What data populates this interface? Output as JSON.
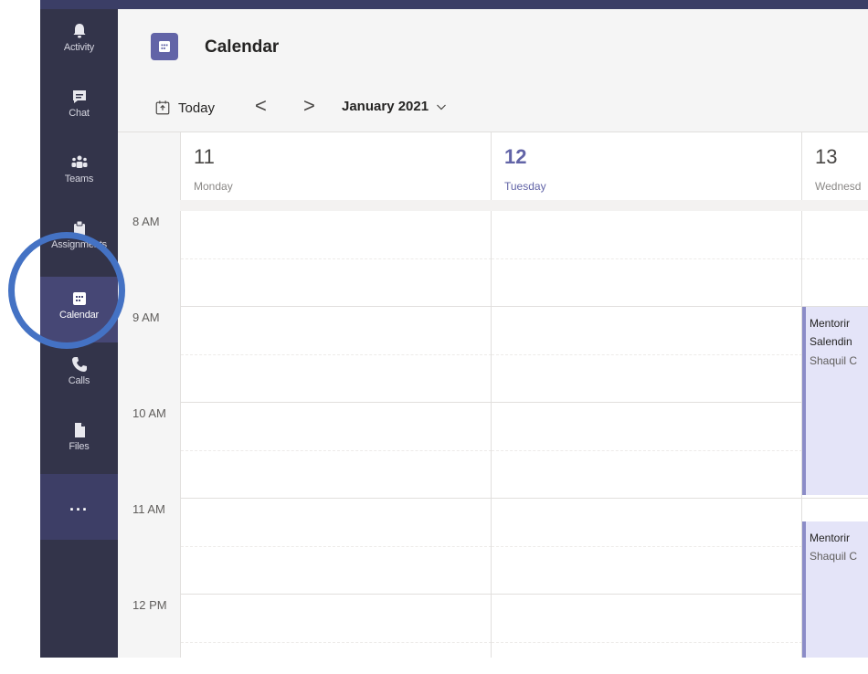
{
  "rail": {
    "items": [
      {
        "label": "Activity",
        "icon": "bell-icon"
      },
      {
        "label": "Chat",
        "icon": "chat-icon"
      },
      {
        "label": "Teams",
        "icon": "teams-icon"
      },
      {
        "label": "Assignments",
        "icon": "assignments-icon"
      },
      {
        "label": "Calendar",
        "icon": "calendar-icon",
        "active": true
      },
      {
        "label": "Calls",
        "icon": "phone-icon"
      },
      {
        "label": "Files",
        "icon": "file-icon"
      }
    ],
    "more_label": "..."
  },
  "header": {
    "title": "Calendar"
  },
  "toolbar": {
    "today_label": "Today",
    "prev_label": "<",
    "next_label": ">",
    "month_label": "January 2021"
  },
  "days": [
    {
      "number": "11",
      "name": "Monday",
      "today": false
    },
    {
      "number": "12",
      "name": "Tuesday",
      "today": true
    },
    {
      "number": "13",
      "name": "Wednesd",
      "today": false
    }
  ],
  "time_labels": [
    "8 AM",
    "9 AM",
    "10 AM",
    "11 AM",
    "12 PM"
  ],
  "events": [
    {
      "line1": "Mentorir",
      "line2": "Salendin",
      "line3": "Shaquil C"
    },
    {
      "line1": "Mentorir",
      "line2": "Shaquil C"
    }
  ],
  "colors": {
    "rail_bg": "#33344a",
    "rail_active": "#464775",
    "accent": "#6264a7",
    "event_bg": "#e4e4f8",
    "highlight_ring": "#4472c4"
  }
}
